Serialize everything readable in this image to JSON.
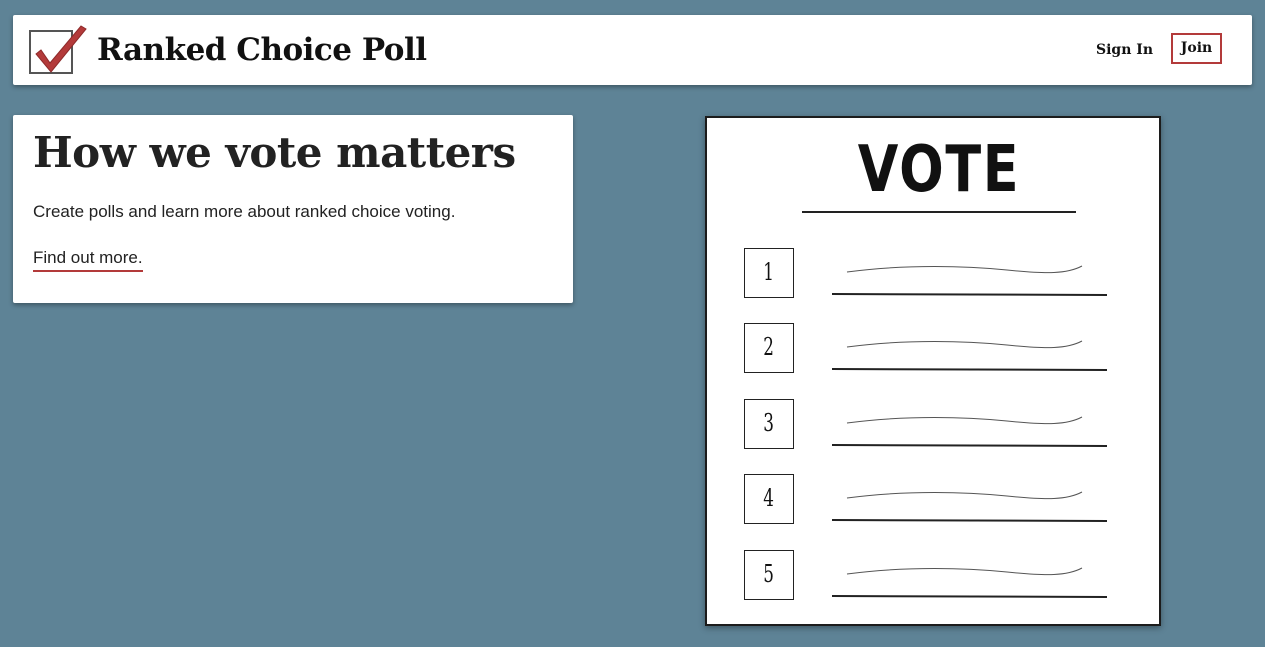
{
  "page": {
    "background_color": "#5e8396",
    "accent_color": "#b33a3a"
  },
  "header": {
    "logo_icon": "checkmark-ballot-icon",
    "brand_name": "Ranked Choice Poll",
    "sign_in_label": "Sign In",
    "join_label": "Join"
  },
  "hero": {
    "heading": "How we vote matters",
    "description": "Create polls and learn more about ranked choice voting.",
    "link_text": "Find out more."
  },
  "ballot": {
    "title": "VOTE",
    "ranks": [
      "1",
      "2",
      "3",
      "4",
      "5"
    ]
  }
}
